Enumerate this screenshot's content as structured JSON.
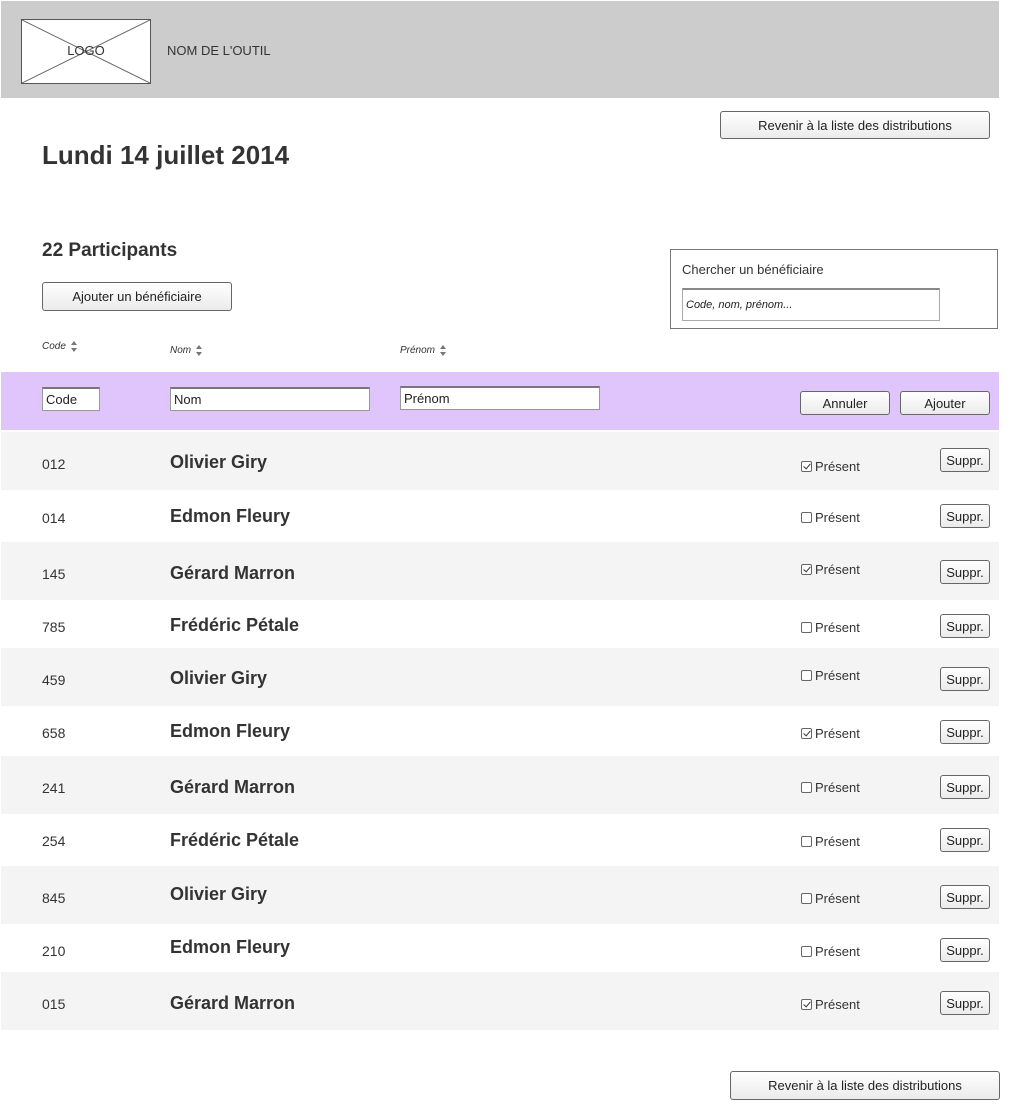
{
  "header": {
    "logo_label": "LOGO",
    "tool_name": "NOM DE L'OUTIL"
  },
  "top_back_button": "Revenir à la liste des distributions",
  "page_title": "Lundi 14 juillet 2014",
  "participants_count": "22 Participants",
  "add_beneficiary_button": "Ajouter un bénéficiaire",
  "search": {
    "label": "Chercher un bénéficiaire",
    "placeholder": "Code, nom, prénom..."
  },
  "columns": {
    "code": "Code",
    "nom": "Nom",
    "prenom": "Prénom"
  },
  "add_form": {
    "code_value": "Code",
    "nom_value": "Nom",
    "prenom_value": "Prénom",
    "cancel_label": "Annuler",
    "add_label": "Ajouter"
  },
  "present_label": "Présent",
  "delete_label": "Suppr.",
  "participants": [
    {
      "code": "012",
      "name": "Olivier Giry",
      "present": true
    },
    {
      "code": "014",
      "name": "Edmon Fleury",
      "present": false
    },
    {
      "code": "145",
      "name": "Gérard Marron",
      "present": true
    },
    {
      "code": "785",
      "name": "Frédéric Pétale",
      "present": false
    },
    {
      "code": "459",
      "name": "Olivier Giry",
      "present": false
    },
    {
      "code": "658",
      "name": "Edmon Fleury",
      "present": true
    },
    {
      "code": "241",
      "name": "Gérard Marron",
      "present": false
    },
    {
      "code": "254",
      "name": "Frédéric Pétale",
      "present": false
    },
    {
      "code": "845",
      "name": "Olivier Giry",
      "present": false
    },
    {
      "code": "210",
      "name": "Edmon Fleury",
      "present": false
    },
    {
      "code": "015",
      "name": "Gérard Marron",
      "present": true
    }
  ],
  "bottom_back_button": "Revenir à la liste des distributions",
  "colors": {
    "header_bg": "#cccccc",
    "add_row_bg": "#dfc5fb",
    "row_shade": "#f4f4f4"
  }
}
